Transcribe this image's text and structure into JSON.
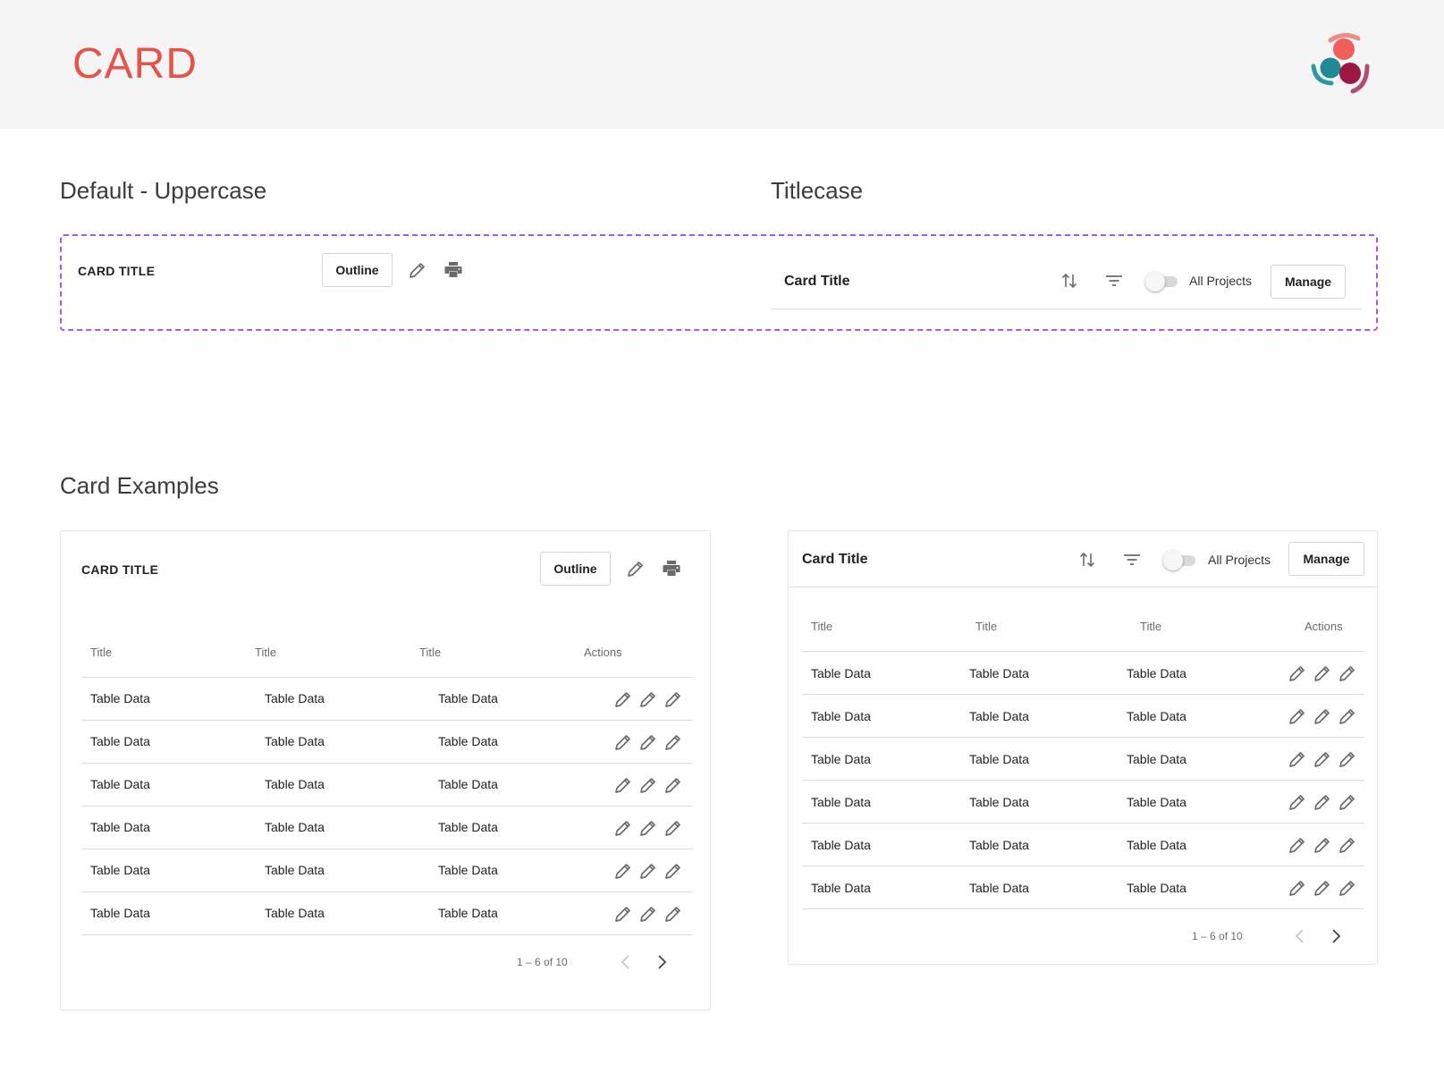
{
  "header": {
    "title": "CARD"
  },
  "sections": {
    "default_upper": "Default - Uppercase",
    "titlecase": "Titlecase",
    "examples": "Card Examples"
  },
  "demo_upper": {
    "title": "CARD TITLE",
    "outline_label": "Outline"
  },
  "demo_title": {
    "title": "Card Title",
    "toggle_label": "All Projects",
    "manage_label": "Manage"
  },
  "example_left": {
    "title": "CARD TITLE",
    "outline_label": "Outline",
    "columns": [
      "Title",
      "Title",
      "Title",
      "Actions"
    ],
    "rows": [
      [
        "Table Data",
        "Table Data",
        "Table Data"
      ],
      [
        "Table Data",
        "Table Data",
        "Table Data"
      ],
      [
        "Table Data",
        "Table Data",
        "Table Data"
      ],
      [
        "Table Data",
        "Table Data",
        "Table Data"
      ],
      [
        "Table Data",
        "Table Data",
        "Table Data"
      ],
      [
        "Table Data",
        "Table Data",
        "Table Data"
      ]
    ],
    "pagination": "1 – 6 of 10"
  },
  "example_right": {
    "title": "Card Title",
    "toggle_label": "All Projects",
    "manage_label": "Manage",
    "columns": [
      "Title",
      "Title",
      "Title",
      "Actions"
    ],
    "rows": [
      [
        "Table Data",
        "Table Data",
        "Table Data"
      ],
      [
        "Table Data",
        "Table Data",
        "Table Data"
      ],
      [
        "Table Data",
        "Table Data",
        "Table Data"
      ],
      [
        "Table Data",
        "Table Data",
        "Table Data"
      ],
      [
        "Table Data",
        "Table Data",
        "Table Data"
      ],
      [
        "Table Data",
        "Table Data",
        "Table Data"
      ]
    ],
    "pagination": "1 – 6 of 10"
  },
  "colors": {
    "brand": "#e5534b",
    "dashed_border": "#a855f7",
    "header_bg": "#f5f5f5",
    "icon": "#6b6b6b"
  },
  "icons": {
    "edit": "pencil-icon",
    "print": "print-icon",
    "sort": "sort-arrows-icon",
    "filter": "filter-icon",
    "prev": "chevron-left-icon",
    "next": "chevron-right-icon",
    "logo": "brand-logo"
  }
}
